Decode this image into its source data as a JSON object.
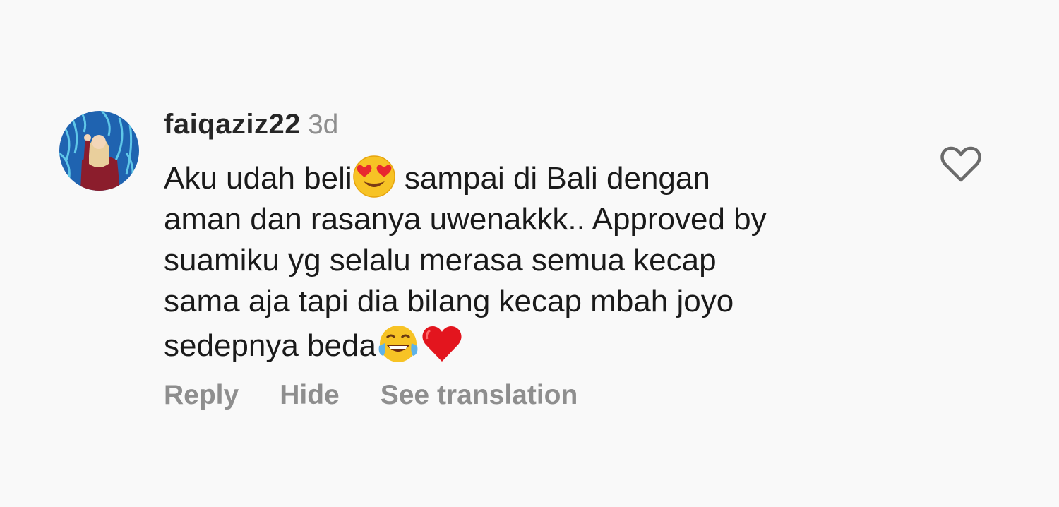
{
  "comment": {
    "username": "faiqaziz22",
    "time": "3d",
    "text_lines": [
      [
        "Aku udah beli",
        " sampai di Bali dengan"
      ],
      "aman dan rasanya uwenakkk.. Approved by",
      "suamiku yg selalu merasa semua kecap",
      "sama aja tapi dia bilang kecap mbah joyo",
      "sedepnya beda"
    ],
    "emojis": [
      "heart-eyes-emoji",
      "tears-of-joy-emoji",
      "red-heart-emoji"
    ],
    "actions": {
      "reply": "Reply",
      "hide": "Hide",
      "see_translation": "See translation"
    },
    "like_icon": "heart-outline-icon"
  },
  "colors": {
    "background": "#f9f9f9",
    "text": "#1a1a1a",
    "secondary": "#8e8e8e"
  }
}
